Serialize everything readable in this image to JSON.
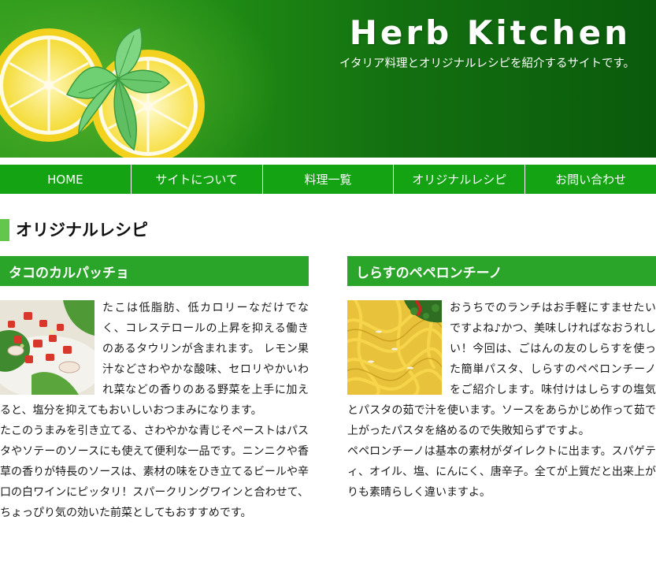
{
  "header": {
    "title": "Herb Kitchen",
    "tagline": "イタリア料理とオリジナルレシピを紹介するサイトです。",
    "image": "lemon-slices-with-mint-image"
  },
  "nav": {
    "items": [
      {
        "label": "HOME"
      },
      {
        "label": "サイトについて"
      },
      {
        "label": "料理一覧"
      },
      {
        "label": "オリジナルレシピ"
      },
      {
        "label": "お問い合わせ"
      }
    ]
  },
  "page": {
    "heading": "オリジナルレシピ"
  },
  "articles": [
    {
      "title": "タコのカルパッチョ",
      "image": "octopus-carpaccio-photo",
      "paragraphs": [
        "たこは低脂肪、低カロリーなだけでなく、コレステロールの上昇を抑える働きのあるタウリンが含まれます。 レモン果汁などさわやかな酸味、セロリやかいわれ菜などの香りのある野菜を上手に加えると、塩分を抑えてもおいしいおつまみになります。",
        "たこのうまみを引き立てる、さわやかな青じそペーストはパスタやソテーのソースにも使えて便利な一品です。ニンニクや香草の香りが特長のソースは、素材の味をひき立てるビールや辛口の白ワインにピッタリ！スパークリングワインと合わせて、ちょっぴり気の効いた前菜としてもおすすめです。"
      ]
    },
    {
      "title": "しらすのペペロンチーノ",
      "image": "shirasu-peperoncino-photo",
      "paragraphs": [
        "おうちでのランチはお手軽にすませたいですよね♪かつ、美味しければなおうれしい！今回は、ごはんの友のしらすを使った簡単パスタ、しらすのペペロンチーノをご紹介します。味付けはしらすの塩気とパスタの茹で汁を使います。ソースをあらかじめ作って茹で上がったパスタを絡めるので失敗知らずですよ。",
        "ペペロンチーノは基本の素材がダイレクトに出ます。スパゲティ、オイル、塩、にんにく、唐辛子。全てが上質だと出来上がりも素晴らしく違いますよ。"
      ]
    }
  ]
}
